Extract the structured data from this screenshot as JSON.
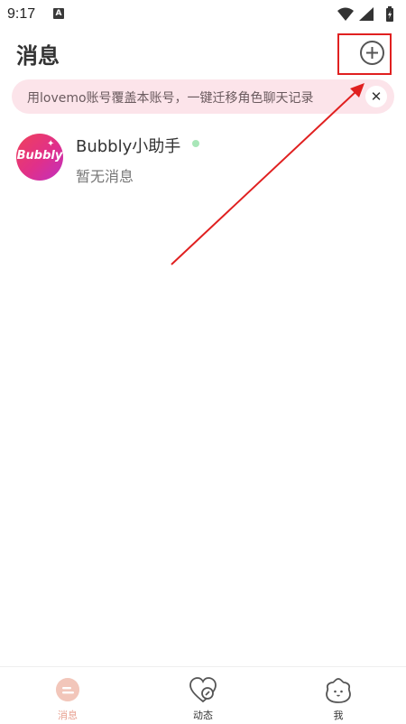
{
  "status_bar": {
    "time": "9:17",
    "indicator_letter": "A"
  },
  "header": {
    "title": "消息"
  },
  "banner": {
    "text": "用lovemo账号覆盖本账号，一键迁移角色聊天记录",
    "close_symbol": "✕"
  },
  "chat_list": [
    {
      "name": "Bubbly小助手",
      "avatar_text": "Bubbly",
      "preview": "暂无消息",
      "online": true
    }
  ],
  "bottom_nav": [
    {
      "label": "消息",
      "active": true,
      "icon": "message-icon"
    },
    {
      "label": "动态",
      "active": false,
      "icon": "moments-icon"
    },
    {
      "label": "我",
      "active": false,
      "icon": "profile-icon"
    }
  ],
  "colors": {
    "accent": "#e8a090",
    "banner_bg": "#fce4ea",
    "annotation": "#e02020",
    "online": "#a8e6b8"
  }
}
